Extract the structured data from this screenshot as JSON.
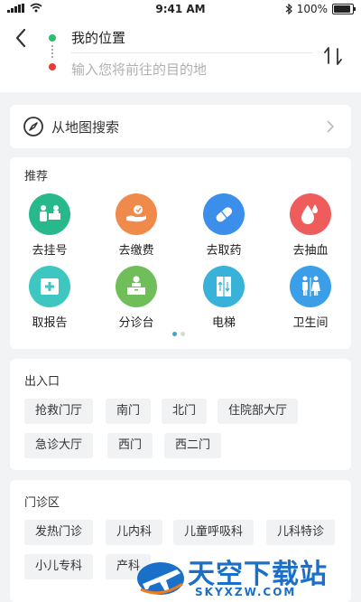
{
  "status_bar": {
    "time": "9:41 AM",
    "battery": "100%"
  },
  "header": {
    "start": "我的位置",
    "destination_placeholder": "输入您将前往的目的地",
    "destination_value": ""
  },
  "map_search": {
    "label": "从地图搜索"
  },
  "recommend": {
    "title": "推荐",
    "items": [
      {
        "label": "去挂号",
        "icon": "registration-icon",
        "color": "#27b98c"
      },
      {
        "label": "去缴费",
        "icon": "payment-icon",
        "color": "#f08a4b"
      },
      {
        "label": "去取药",
        "icon": "pill-icon",
        "color": "#3b8eea"
      },
      {
        "label": "去抽血",
        "icon": "blood-drop-icon",
        "color": "#ee5c5c"
      },
      {
        "label": "取报告",
        "icon": "report-icon",
        "color": "#3ec6c0"
      },
      {
        "label": "分诊台",
        "icon": "triage-desk-icon",
        "color": "#6fbe59"
      },
      {
        "label": "电梯",
        "icon": "elevator-icon",
        "color": "#38b2d8"
      },
      {
        "label": "卫生间",
        "icon": "restroom-icon",
        "color": "#3a9ee8"
      }
    ],
    "page_dots": 2,
    "active_dot": 0
  },
  "entrances": {
    "title": "出入口",
    "tags": [
      "抢救门厅",
      "南门",
      "北门",
      "住院部大厅",
      "急诊大厅",
      "西门",
      "西二门"
    ]
  },
  "clinics": {
    "title": "门诊区",
    "tags": [
      "发热门诊",
      "儿内科",
      "儿童呼吸科",
      "儿科特诊",
      "小儿专科",
      "产科"
    ]
  },
  "watermark": {
    "main": "天空下载站",
    "sub": "SKYXZW.COM"
  }
}
